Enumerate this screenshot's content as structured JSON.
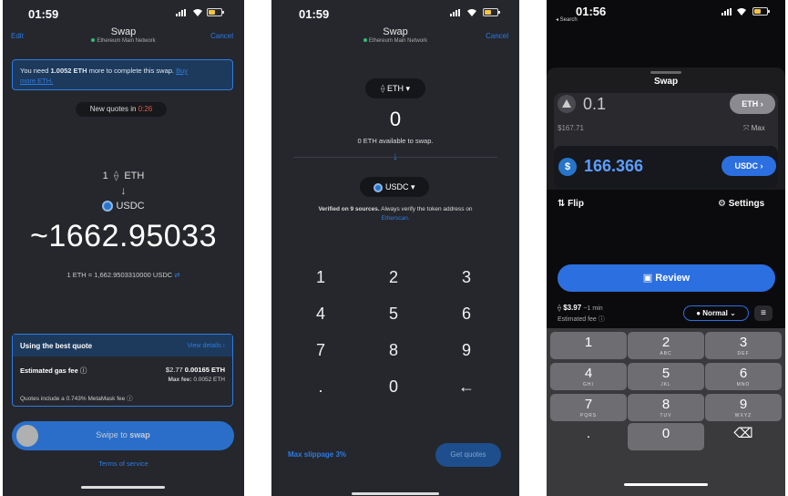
{
  "panel1": {
    "time": "01:59",
    "edit": "Edit",
    "title": "Swap",
    "network": "Ethereum Main Network",
    "cancel": "Cancel",
    "alert_pre": "You need ",
    "alert_bold": "1.0052 ETH",
    "alert_mid": " more to complete this swap. ",
    "alert_link1": "Buy",
    "alert_link2": "more ETH.",
    "new_quotes_label": "New quotes in ",
    "new_quotes_timer": "0:26",
    "from_amount": "1",
    "from_token": "ETH",
    "arrow": "↓",
    "to_token": "USDC",
    "big_amount": "~1662.95033",
    "rate": "1 ETH = 1,662.9503310000 USDC",
    "best_quote": "Using the best quote",
    "view_details": "View details ›",
    "gas_label": "Estimated gas fee",
    "gas_usd": "$2.77",
    "gas_eth": "0.00165 ETH",
    "max_fee_label": "Max fee:",
    "max_fee_value": "0.0052 ETH",
    "quotes_include": "Quotes include a 0.743% MetaMask fee",
    "swipe_pre": "Swipe to ",
    "swipe_bold": "swap",
    "terms": "Terms of service"
  },
  "panel2": {
    "time": "01:59",
    "title": "Swap",
    "network": "Ethereum Main Network",
    "cancel": "Cancel",
    "from_token": "ETH",
    "amount": "0",
    "available": "0 ETH available to swap.",
    "arrow": "↓",
    "to_token": "USDC",
    "verified_bold": "Verified on 9 sources.",
    "verified_rest": " Always verify the token address on",
    "etherscan": "Etherscan.",
    "keys": [
      "1",
      "2",
      "3",
      "4",
      "5",
      "6",
      "7",
      "8",
      "9",
      ".",
      "0",
      "←"
    ],
    "max_slippage": "Max slippage 3%",
    "get_quotes": "Get quotes"
  },
  "panel3": {
    "time": "01:56",
    "back": "◂ Search",
    "title": "Swap",
    "from_amount": "0.1",
    "from_token": "ETH ›",
    "from_usd": "$167.71",
    "max": "Max",
    "to_amount": "166.366",
    "to_token": "USDC ›",
    "flip": "Flip",
    "settings": "Settings",
    "review": "Review",
    "fee_value": "$3.97",
    "fee_time": "~1 min",
    "fee_label": "Estimated fee",
    "speed": "Normal",
    "keys": [
      {
        "n": "1",
        "s": ""
      },
      {
        "n": "2",
        "s": "ABC"
      },
      {
        "n": "3",
        "s": "DEF"
      },
      {
        "n": "4",
        "s": "GHI"
      },
      {
        "n": "5",
        "s": "JKL"
      },
      {
        "n": "6",
        "s": "MNO"
      },
      {
        "n": "7",
        "s": "PQRS"
      },
      {
        "n": "8",
        "s": "TUV"
      },
      {
        "n": "9",
        "s": "WXYZ"
      },
      {
        "n": ".",
        "s": ""
      },
      {
        "n": "0",
        "s": ""
      },
      {
        "n": "⌫",
        "s": ""
      }
    ]
  },
  "colors": {
    "accent_blue": "#2c7be5",
    "timer_red": "#e2574c",
    "panel_dark": "#25272c",
    "coinbase_blue": "#1f6fe0"
  }
}
